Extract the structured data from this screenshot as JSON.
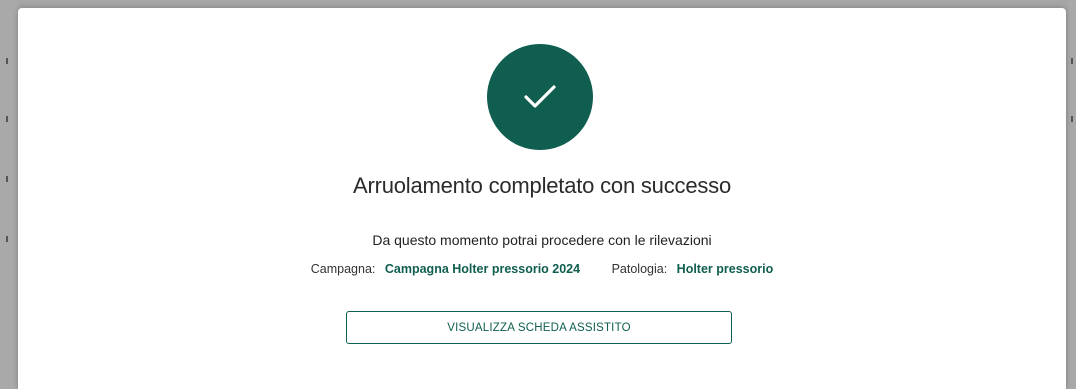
{
  "modal": {
    "title": "Arruolamento completato con successo",
    "message": "Da questo momento potrai procedere con le rilevazioni",
    "campaign_label": "Campagna:",
    "campaign_value": "Campagna Holter pressorio 2024",
    "pathology_label": "Patologia:",
    "pathology_value": "Holter pressorio",
    "button_label": "VISUALIZZA SCHEDA ASSISTITO",
    "icon": "checkmark-icon"
  },
  "colors": {
    "accent": "#0f5e4f",
    "backdrop": "#a6a6a6"
  }
}
